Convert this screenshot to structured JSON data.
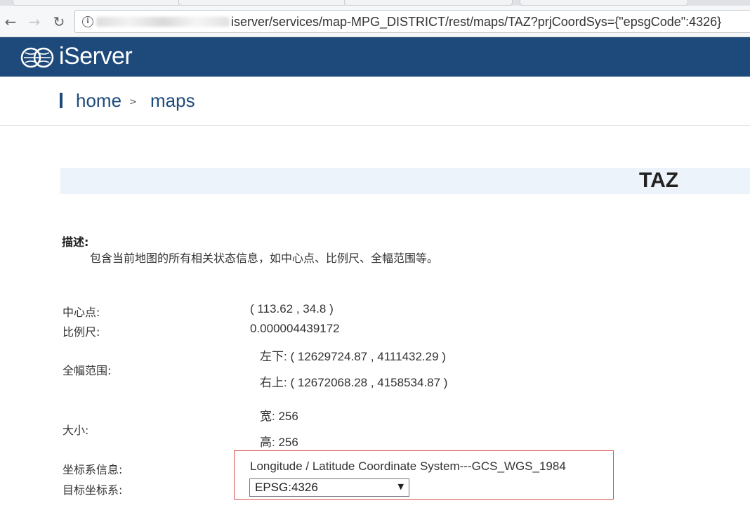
{
  "browser": {
    "url_path": "iserver/services/map-MPG_DISTRICT/rest/maps/TAZ?prjCoordSys={\"epsgCode\":4326}"
  },
  "brand": {
    "name": "iServer",
    "color": "#1d4a7a"
  },
  "breadcrumb": {
    "home": "home",
    "separator": ">",
    "current": "maps"
  },
  "page": {
    "title": "TAZ",
    "description_label": "描述:",
    "description_text": "包含当前地图的所有相关状态信息，如中心点、比例尺、全幅范围等。"
  },
  "properties": {
    "center_label": "中心点:",
    "center_value": "( 113.62 , 34.8 )",
    "scale_label": "比例尺:",
    "scale_value": "0.000004439172",
    "bounds_label": "全幅范围:",
    "bounds_lower_left": "左下:  ( 12629724.87 , 4111432.29 )",
    "bounds_upper_right": "右上:  ( 12672068.28 , 4158534.87 )",
    "size_label": "大小:",
    "size_width": "宽:  256",
    "size_height": "高:  256",
    "coord_sys_label": "坐标系信息:",
    "coord_sys_value": "Longitude / Latitude Coordinate System---GCS_WGS_1984",
    "target_cs_label": "目标坐标系:",
    "target_cs_selected": "EPSG:4326"
  }
}
